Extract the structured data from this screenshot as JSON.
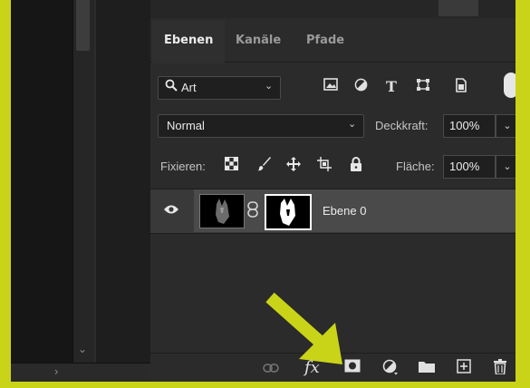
{
  "tabs": [
    "Ebenen",
    "Kanäle",
    "Pfade"
  ],
  "filter": {
    "label": "Art",
    "icon": "search-icon"
  },
  "filter_icons": [
    "image-icon",
    "adjustment-icon",
    "type-icon",
    "shape-icon",
    "smart-object-icon"
  ],
  "blend_mode": "Normal",
  "opacity": {
    "label": "Deckkraft:",
    "value": "100%"
  },
  "lock": {
    "label": "Fixieren:",
    "icons": [
      "lock-transparent-icon",
      "lock-paint-icon",
      "lock-move-icon",
      "lock-artboard-icon",
      "lock-all-icon"
    ]
  },
  "fill": {
    "label": "Fläche:",
    "value": "100%"
  },
  "layer": {
    "name": "Ebene 0"
  },
  "bottom_icons": [
    "link-layers-icon",
    "fx-icon",
    "add-mask-icon",
    "adjustment-layer-icon",
    "group-folder-icon",
    "new-layer-icon",
    "delete-icon"
  ],
  "fx_label": "fx",
  "colors": {
    "accent": "#c9d418",
    "panel": "#2b2b2b",
    "selected_row": "#4a4a4a"
  }
}
